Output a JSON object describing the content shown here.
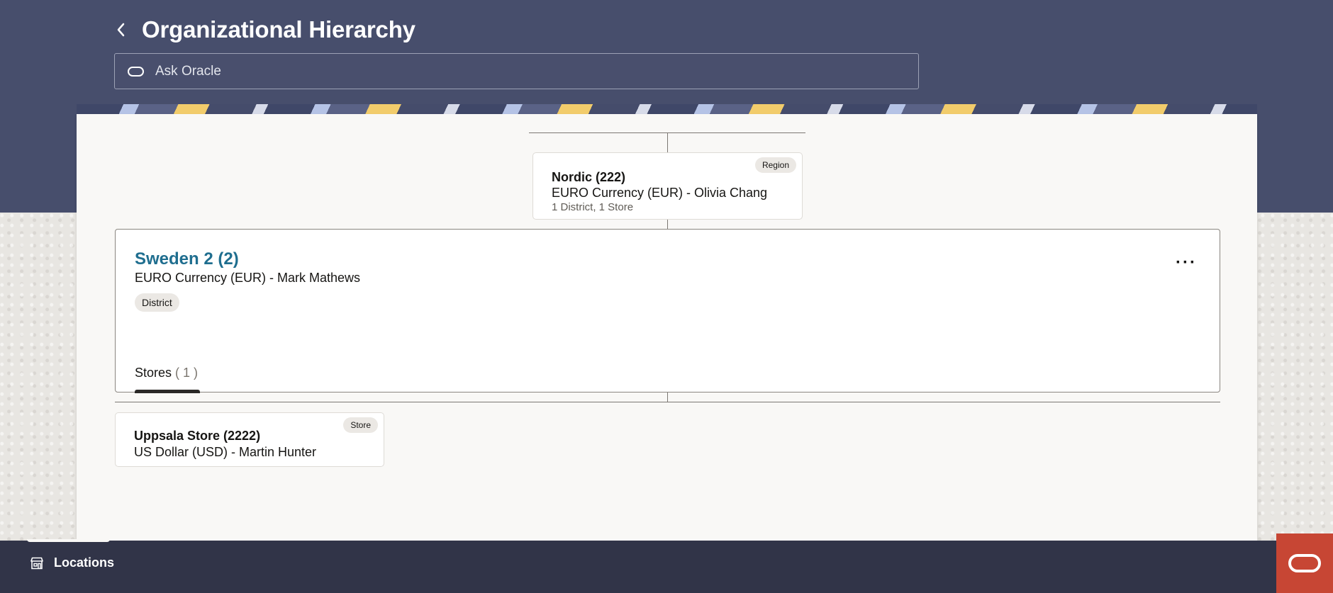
{
  "page": {
    "title": "Organizational Hierarchy"
  },
  "search": {
    "placeholder": "Ask Oracle"
  },
  "region_node": {
    "name": "Nordic (222)",
    "detail": "EURO Currency (EUR) - Olivia Chang",
    "summary": "1 District, 1 Store",
    "badge": "Region"
  },
  "district_node": {
    "name": "Sweden 2 (2)",
    "detail": "EURO Currency (EUR) - Mark Mathews",
    "type": "District",
    "more_label": "···",
    "tab": {
      "label": "Stores",
      "count": "( 1 )"
    }
  },
  "store_node": {
    "name": "Uppsala Store (2222)",
    "detail": "US Dollar (USD) - Martin Hunter",
    "badge": "Store"
  },
  "footer": {
    "locations_label": "Locations"
  },
  "colors": {
    "header_bg": "#474e6c",
    "footer_bg": "#313448",
    "link": "#1f6e8f",
    "oracle_red": "#c74634"
  },
  "icons": {
    "back": "chevron-left-icon",
    "ask": "oracle-pill-icon",
    "locations": "storefront-icon",
    "oracle": "oracle-logo-icon"
  }
}
